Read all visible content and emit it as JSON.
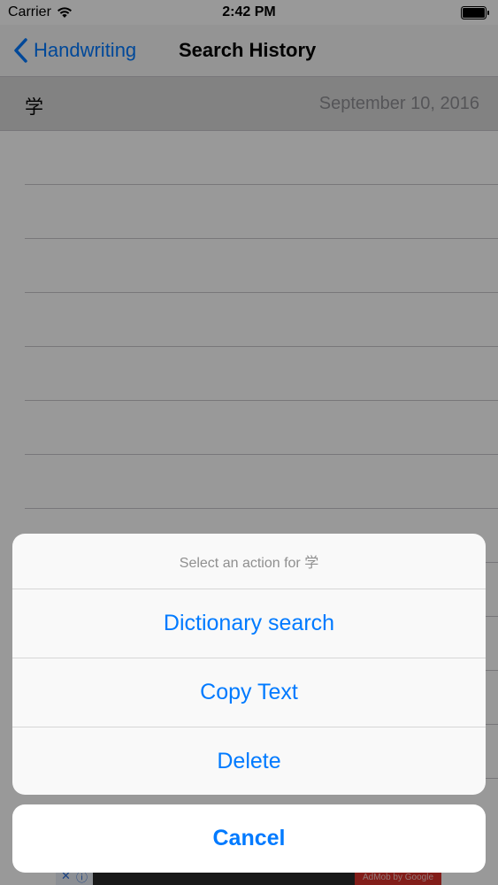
{
  "status_bar": {
    "carrier": "Carrier",
    "time": "2:42 PM",
    "wifi_icon": "wifi-icon",
    "battery_icon": "battery-icon"
  },
  "nav": {
    "back_label": "Handwriting",
    "title": "Search History",
    "back_icon": "chevron-left-icon"
  },
  "history": {
    "items": [
      {
        "character": "学",
        "date": "September 10, 2016"
      }
    ]
  },
  "action_sheet": {
    "title": "Select an action for 学",
    "actions": [
      {
        "label": "Dictionary search"
      },
      {
        "label": "Copy Text"
      },
      {
        "label": "Delete"
      }
    ],
    "cancel_label": "Cancel"
  },
  "ad": {
    "attribution": "AdMob by Google"
  },
  "colors": {
    "accent": "#007aff",
    "overlay": "rgba(0,0,0,0.4)",
    "secondary_text": "#8e8e93"
  }
}
